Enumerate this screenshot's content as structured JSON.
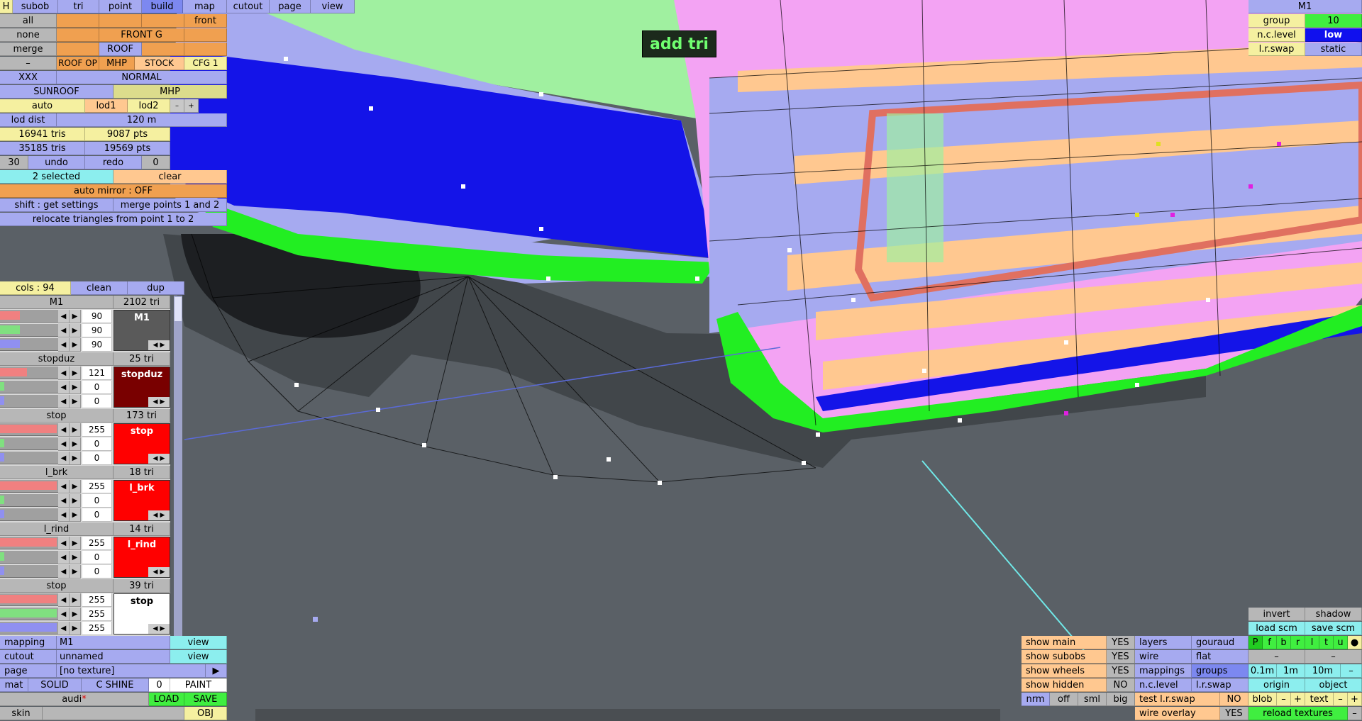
{
  "toolbar": {
    "h": "H",
    "tabs": [
      "subob",
      "tri",
      "point",
      "build",
      "map",
      "cutout",
      "page",
      "view"
    ],
    "active_tab": "build"
  },
  "left_panel": {
    "all": "all",
    "none": "none",
    "merge": "merge",
    "dash": "–",
    "front": "front",
    "front_g": "FRONT G",
    "roof": "ROOF",
    "roof_op": "ROOF OP",
    "mhp": "MHP",
    "stock": "STOCK",
    "cfg1": "CFG 1",
    "xxx": "XXX",
    "normal": "NORMAL",
    "sunroof": "SUNROOF",
    "mhp2": "MHP",
    "auto": "auto",
    "lod1": "lod1",
    "lod2": "lod2",
    "minus": "–",
    "plus": "+",
    "lod_dist_label": "lod dist",
    "lod_dist_value": "120 m",
    "tris1": "16941 tris",
    "pts1": "9087 pts",
    "tris2": "35185 tris",
    "pts2": "19569 pts",
    "undo_count": "30",
    "undo": "undo",
    "redo": "redo",
    "redo_count": "0",
    "selected": "2 selected",
    "clear": "clear",
    "auto_mirror": "auto mirror : OFF",
    "shift": "shift : get settings",
    "merge_points": "merge points 1 and 2",
    "relocate": "relocate triangles from point 1 to 2"
  },
  "cols_panel": {
    "cols": "cols : 94",
    "clean": "clean",
    "dup": "dup",
    "materials": [
      {
        "name": "M1",
        "tris": "2102 tri",
        "r": "90",
        "g": "90",
        "b": "90",
        "swatch_label": "M1",
        "swatch_color": "#5a5a5a",
        "r_frac": 0.35,
        "g_frac": 0.35,
        "b_frac": 0.35
      },
      {
        "name": "stopduz",
        "tris": "25 tri",
        "r": "121",
        "g": "0",
        "b": "0",
        "swatch_label": "stopduz",
        "swatch_color": "#790000",
        "r_frac": 0.47,
        "g_frac": 0.0,
        "b_frac": 0.0
      },
      {
        "name": "stop",
        "tris": "173 tri",
        "r": "255",
        "g": "0",
        "b": "0",
        "swatch_label": "stop",
        "swatch_color": "#ff0000",
        "r_frac": 1.0,
        "g_frac": 0.0,
        "b_frac": 0.0
      },
      {
        "name": "l_brk",
        "tris": "18 tri",
        "r": "255",
        "g": "0",
        "b": "0",
        "swatch_label": "l_brk",
        "swatch_color": "#ff0000",
        "r_frac": 1.0,
        "g_frac": 0.0,
        "b_frac": 0.0
      },
      {
        "name": "l_rind",
        "tris": "14 tri",
        "r": "255",
        "g": "0",
        "b": "0",
        "swatch_label": "l_rind",
        "swatch_color": "#ff0000",
        "r_frac": 1.0,
        "g_frac": 0.0,
        "b_frac": 0.0
      },
      {
        "name": "stop",
        "tris": "39 tri",
        "r": "255",
        "g": "255",
        "b": "255",
        "swatch_label": "stop",
        "swatch_color": "#ffffff",
        "r_frac": 1.0,
        "g_frac": 1.0,
        "b_frac": 1.0
      }
    ]
  },
  "bottom_left": {
    "mapping": "mapping",
    "mapping_value": "M1",
    "view": "view",
    "cutout": "cutout",
    "cutout_value": "unnamed",
    "view2": "view",
    "page": "page",
    "page_value": "[no texture]",
    "page_arrow": "▶",
    "mat": "mat",
    "solid": "SOLID",
    "cshine": "C SHINE",
    "zero": "0",
    "paint": "PAINT",
    "file_name": "audi",
    "file_mark": "*",
    "load": "LOAD",
    "save": "SAVE",
    "skin": "skin",
    "obj": "OBJ"
  },
  "top_right": {
    "name": "M1",
    "group_label": "group",
    "group_value": "10",
    "nc_level_label": "n.c.level",
    "nc_level_value": "low",
    "lr_swap_label": "l.r.swap",
    "lr_swap_value": "static"
  },
  "overlay": {
    "add_tri": "add tri"
  },
  "bottom_right": {
    "show_main": "show main",
    "show_main_v": "YES",
    "show_subobs": "show subobs",
    "show_subobs_v": "YES",
    "show_wheels": "show wheels",
    "show_wheels_v": "YES",
    "show_hidden": "show hidden",
    "show_hidden_v": "NO",
    "nrm": "nrm",
    "off": "off",
    "sml": "sml",
    "big": "big",
    "layers": "layers",
    "gouraud": "gouraud",
    "wire": "wire",
    "flat": "flat",
    "mappings": "mappings",
    "groups": "groups",
    "nc_level": "n.c.level",
    "lr_swap": "l.r.swap",
    "test_lr_swap": "test l.r.swap",
    "test_no": "NO",
    "wire_overlay": "wire overlay",
    "wire_overlay_v": "YES",
    "invert": "invert",
    "shadow": "shadow",
    "load_scm": "load scm",
    "save_scm": "save scm",
    "view_letters": [
      "P",
      "f",
      "b",
      "r",
      "l",
      "t",
      "u"
    ],
    "dot": "●",
    "dash1": "–",
    "dash2": "–",
    "s01": "0.1m",
    "s1": "1m",
    "s10": "10m",
    "sdash": "–",
    "origin": "origin",
    "object": "object",
    "blob": "blob",
    "bminus": "–",
    "bplus": "+",
    "text": "text",
    "tminus": "–",
    "tplus": "+",
    "reload": "reload textures",
    "rdash": "–"
  },
  "colors": {
    "viewport_bg": "#5a6066",
    "car_pink": "#f3a3f3",
    "car_lavender": "#a6aaf0",
    "car_blue": "#1010ee",
    "grille_peach": "#ffc890",
    "hl_green": "#22ee22",
    "windshield_green": "#a0f0a0"
  }
}
